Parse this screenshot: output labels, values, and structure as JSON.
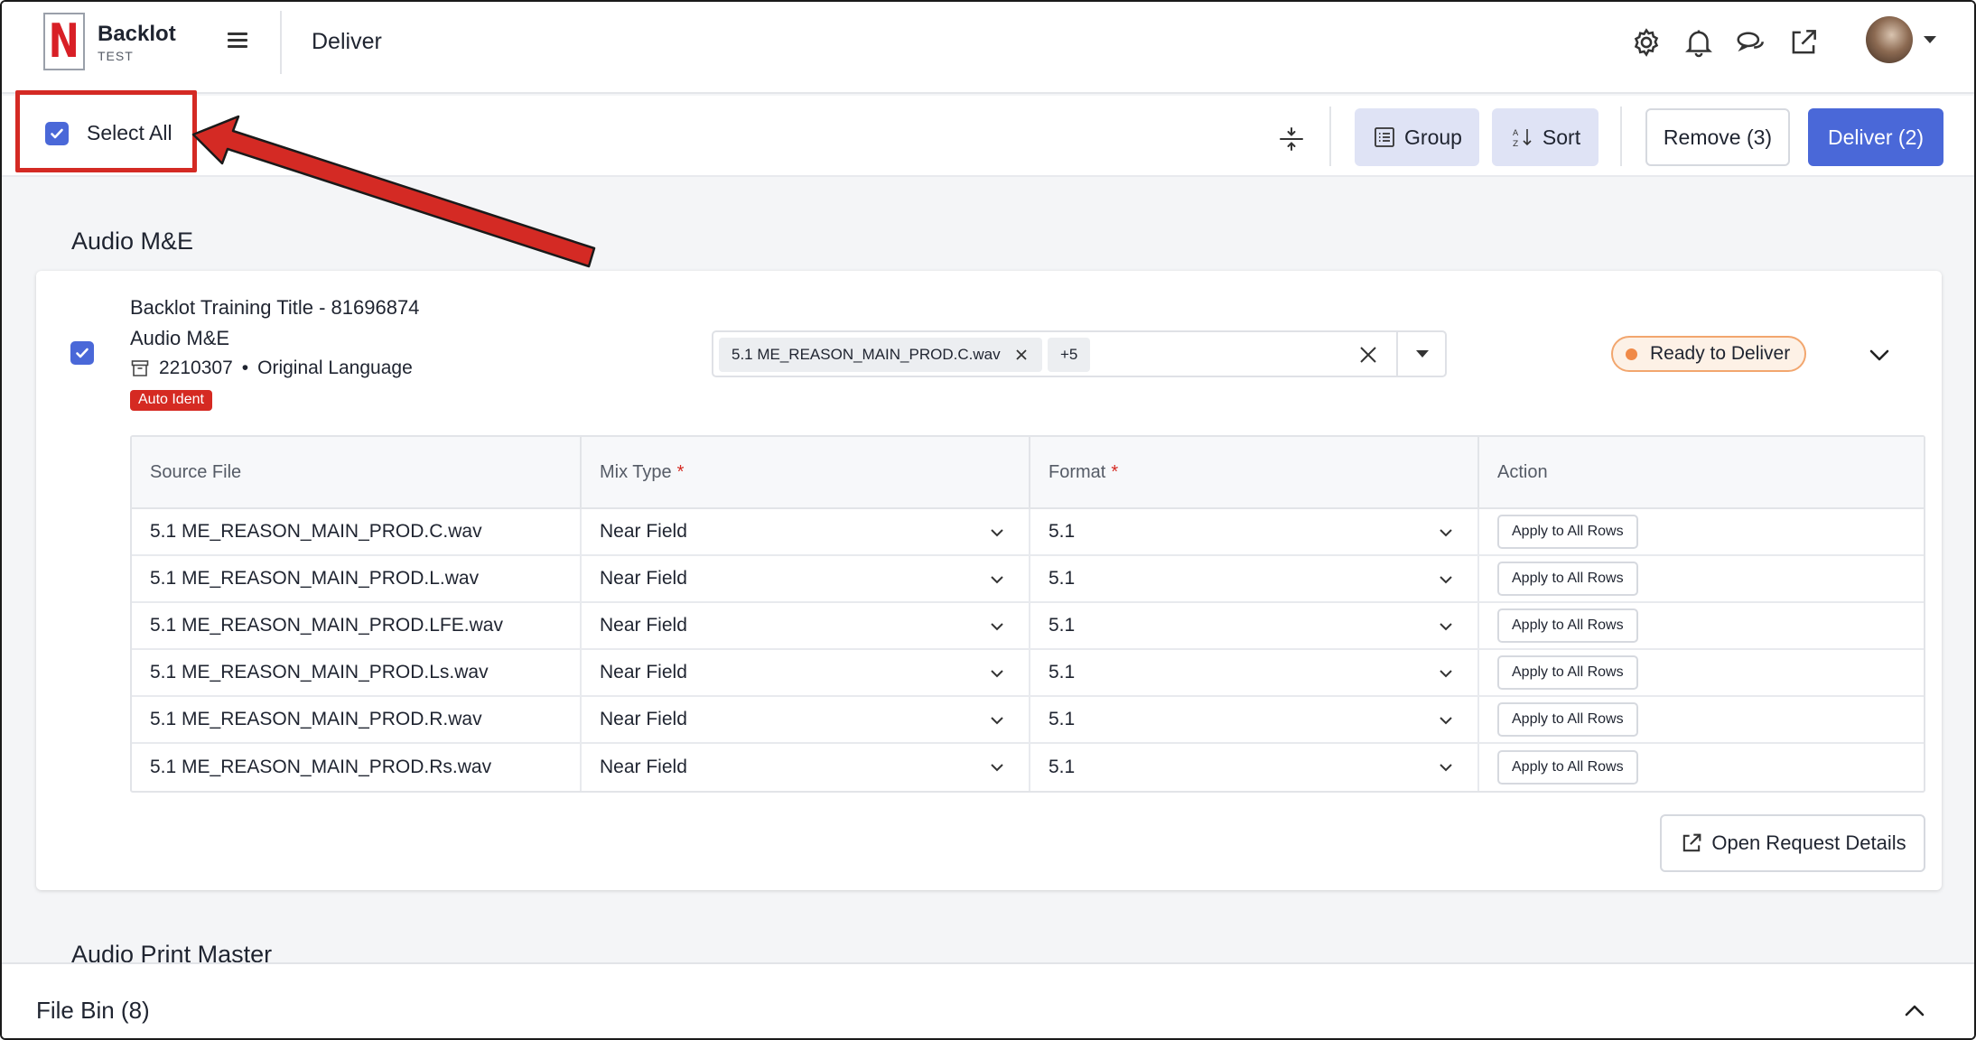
{
  "app": {
    "logo_letter": "N",
    "name": "Backlot",
    "environment": "TEST",
    "page_title": "Deliver",
    "brand_color": "#d81f26"
  },
  "header_icons": [
    "gear-icon",
    "bell-icon",
    "chat-icon",
    "external-link-icon"
  ],
  "toolbar": {
    "select_all_label": "Select All",
    "select_all_checked": true,
    "group_label": "Group",
    "sort_label": "Sort",
    "remove_label": "Remove (3)",
    "deliver_label": "Deliver (2)",
    "accent_color": "#4a68d8"
  },
  "sections": [
    {
      "title": "Audio M&E",
      "card": {
        "checked": true,
        "title": "Backlot Training Title - 81696874",
        "subtitle": "Audio M&E",
        "request_id": "2210307",
        "separator": "•",
        "language": "Original Language",
        "tag": "Auto Ident",
        "file_chip": "5.1 ME_REASON_MAIN_PROD.C.wav",
        "more_chip": "+5",
        "status": "Ready to Deliver",
        "table": {
          "headers": [
            "Source File",
            "Mix Type",
            "Format",
            "Action"
          ],
          "required_marker": "*",
          "rows": [
            {
              "source": "5.1 ME_REASON_MAIN_PROD.C.wav",
              "mix": "Near Field",
              "format": "5.1",
              "action": "Apply to All Rows"
            },
            {
              "source": "5.1 ME_REASON_MAIN_PROD.L.wav",
              "mix": "Near Field",
              "format": "5.1",
              "action": "Apply to All Rows"
            },
            {
              "source": "5.1 ME_REASON_MAIN_PROD.LFE.wav",
              "mix": "Near Field",
              "format": "5.1",
              "action": "Apply to All Rows"
            },
            {
              "source": "5.1 ME_REASON_MAIN_PROD.Ls.wav",
              "mix": "Near Field",
              "format": "5.1",
              "action": "Apply to All Rows"
            },
            {
              "source": "5.1 ME_REASON_MAIN_PROD.R.wav",
              "mix": "Near Field",
              "format": "5.1",
              "action": "Apply to All Rows"
            },
            {
              "source": "5.1 ME_REASON_MAIN_PROD.Rs.wav",
              "mix": "Near Field",
              "format": "5.1",
              "action": "Apply to All Rows"
            }
          ]
        },
        "open_details_label": "Open Request Details"
      }
    },
    {
      "title": "Audio Print Master"
    }
  ],
  "file_bin": {
    "title": "File Bin (8)"
  },
  "status_colors": {
    "ready_bg": "#fdf1e6",
    "ready_border": "#f2a66e",
    "ready_dot": "#f08a48",
    "tag_bg": "#d52a22",
    "annotation_red": "#d42a24"
  }
}
